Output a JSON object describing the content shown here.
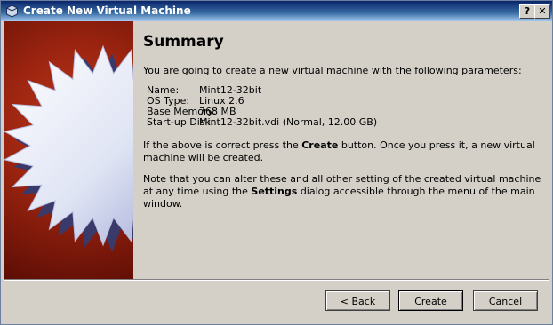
{
  "window": {
    "title": "Create New Virtual Machine",
    "help_button": "?",
    "close_button": "✕"
  },
  "summary": {
    "heading": "Summary",
    "intro": "You are going to create a new virtual machine with the following parameters:",
    "params": [
      {
        "key": "Name:",
        "value": "Mint12-32bit"
      },
      {
        "key": "OS Type:",
        "value": "Linux 2.6"
      },
      {
        "key": "Base Memory:",
        "value": "768 MB"
      },
      {
        "key": "Start-up Disk:",
        "value": "Mint12-32bit.vdi (Normal, 12.00 GB)"
      }
    ],
    "p1_before": "If the above is correct press the ",
    "p1_bold": "Create",
    "p1_after": " button. Once you press it, a new virtual machine will be created.",
    "p2_before": "Note that you can alter these and all other setting of the created virtual machine at any time using the ",
    "p2_bold": "Settings",
    "p2_after": " dialog accessible through the menu of the main window."
  },
  "buttons": {
    "back": "< Back",
    "create": "Create",
    "cancel": "Cancel"
  },
  "icons": {
    "app": "virtualbox-icon",
    "sidebar": "starburst-icon"
  }
}
